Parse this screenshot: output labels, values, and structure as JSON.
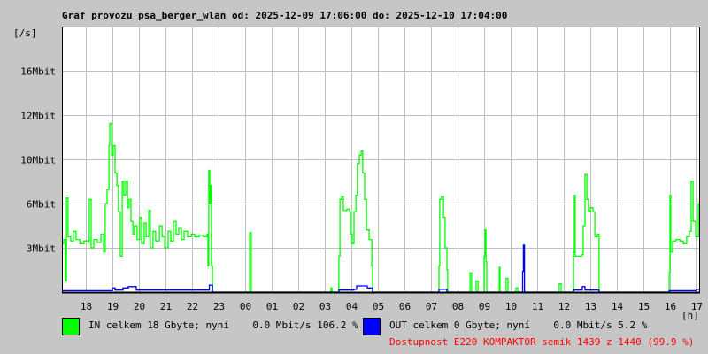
{
  "chart_data": {
    "type": "line",
    "title": "Graf provozu psa_berger_wlan od: 2025-12-09 17:06:00 do: 2025-12-10 17:04:00",
    "ylabel": "[/s]",
    "xlabel": "[h]",
    "x_unit": "hours since 2025-12-09 17:06",
    "xlim": [
      0,
      24
    ],
    "ylim": [
      0,
      19.2
    ],
    "y_unit": "Mbit/s",
    "grid": true,
    "y_ticks": [
      {
        "value": 3.2,
        "label": "3Mbit"
      },
      {
        "value": 6.4,
        "label": "6Mbit"
      },
      {
        "value": 9.6,
        "label": "10Mbit"
      },
      {
        "value": 12.8,
        "label": "12Mbit"
      },
      {
        "value": 16.0,
        "label": "16Mbit"
      }
    ],
    "x_ticks": [
      {
        "value": 0.9,
        "label": "18"
      },
      {
        "value": 1.9,
        "label": "19"
      },
      {
        "value": 2.9,
        "label": "20"
      },
      {
        "value": 3.9,
        "label": "21"
      },
      {
        "value": 4.9,
        "label": "22"
      },
      {
        "value": 5.9,
        "label": "23"
      },
      {
        "value": 6.9,
        "label": "00"
      },
      {
        "value": 7.9,
        "label": "01"
      },
      {
        "value": 8.9,
        "label": "02"
      },
      {
        "value": 9.9,
        "label": "03"
      },
      {
        "value": 10.9,
        "label": "04"
      },
      {
        "value": 11.9,
        "label": "05"
      },
      {
        "value": 12.9,
        "label": "06"
      },
      {
        "value": 13.9,
        "label": "07"
      },
      {
        "value": 14.9,
        "label": "08"
      },
      {
        "value": 15.9,
        "label": "09"
      },
      {
        "value": 16.9,
        "label": "10"
      },
      {
        "value": 17.9,
        "label": "11"
      },
      {
        "value": 18.9,
        "label": "12"
      },
      {
        "value": 19.9,
        "label": "13"
      },
      {
        "value": 20.9,
        "label": "14"
      },
      {
        "value": 21.9,
        "label": "15"
      },
      {
        "value": 22.9,
        "label": "16"
      },
      {
        "value": 23.9,
        "label": "17"
      }
    ],
    "series": [
      {
        "name": "IN",
        "color": "#00ff00",
        "points": [
          [
            0,
            3.5
          ],
          [
            0.07,
            3.8
          ],
          [
            0.13,
            0.8
          ],
          [
            0.17,
            6.8
          ],
          [
            0.23,
            4.0
          ],
          [
            0.33,
            3.7
          ],
          [
            0.43,
            4.4
          ],
          [
            0.53,
            3.8
          ],
          [
            0.67,
            3.5
          ],
          [
            0.83,
            3.7
          ],
          [
            1.0,
            3.6
          ],
          [
            1.03,
            6.7
          ],
          [
            1.1,
            3.2
          ],
          [
            1.2,
            3.8
          ],
          [
            1.33,
            3.6
          ],
          [
            1.47,
            4.2
          ],
          [
            1.57,
            2.9
          ],
          [
            1.63,
            6.4
          ],
          [
            1.7,
            7.4
          ],
          [
            1.77,
            10.6
          ],
          [
            1.8,
            12.2
          ],
          [
            1.87,
            9.9
          ],
          [
            1.93,
            10.6
          ],
          [
            2.0,
            8.6
          ],
          [
            2.07,
            7.7
          ],
          [
            2.13,
            5.8
          ],
          [
            2.2,
            2.6
          ],
          [
            2.27,
            8.0
          ],
          [
            2.33,
            7.0
          ],
          [
            2.4,
            8.0
          ],
          [
            2.47,
            6.1
          ],
          [
            2.53,
            6.7
          ],
          [
            2.6,
            5.1
          ],
          [
            2.67,
            4.2
          ],
          [
            2.73,
            4.8
          ],
          [
            2.83,
            3.8
          ],
          [
            2.93,
            5.4
          ],
          [
            3.0,
            3.5
          ],
          [
            3.1,
            5.0
          ],
          [
            3.17,
            4.0
          ],
          [
            3.27,
            5.9
          ],
          [
            3.33,
            3.2
          ],
          [
            3.43,
            4.4
          ],
          [
            3.53,
            3.7
          ],
          [
            3.67,
            4.8
          ],
          [
            3.77,
            4.0
          ],
          [
            3.87,
            3.2
          ],
          [
            4.0,
            4.4
          ],
          [
            4.1,
            3.7
          ],
          [
            4.2,
            5.1
          ],
          [
            4.3,
            4.2
          ],
          [
            4.4,
            4.6
          ],
          [
            4.5,
            3.8
          ],
          [
            4.6,
            4.4
          ],
          [
            4.73,
            4.0
          ],
          [
            4.87,
            4.2
          ],
          [
            5.0,
            4.0
          ],
          [
            5.17,
            4.1
          ],
          [
            5.33,
            4.0
          ],
          [
            5.47,
            4.2
          ],
          [
            5.5,
            1.9
          ],
          [
            5.53,
            8.8
          ],
          [
            5.57,
            6.4
          ],
          [
            5.6,
            7.7
          ],
          [
            5.63,
            1.9
          ],
          [
            5.67,
            0
          ],
          [
            7.03,
            0
          ],
          [
            7.07,
            4.3
          ],
          [
            7.13,
            0
          ],
          [
            10.13,
            0.3
          ],
          [
            10.17,
            0
          ],
          [
            10.43,
            2.6
          ],
          [
            10.47,
            6.7
          ],
          [
            10.53,
            6.9
          ],
          [
            10.6,
            5.9
          ],
          [
            10.73,
            6.0
          ],
          [
            10.83,
            5.8
          ],
          [
            10.87,
            4.2
          ],
          [
            10.93,
            3.5
          ],
          [
            11.0,
            5.8
          ],
          [
            11.07,
            7.0
          ],
          [
            11.13,
            9.3
          ],
          [
            11.2,
            9.9
          ],
          [
            11.27,
            10.2
          ],
          [
            11.33,
            8.6
          ],
          [
            11.4,
            6.7
          ],
          [
            11.47,
            4.5
          ],
          [
            11.57,
            3.8
          ],
          [
            11.67,
            1.9
          ],
          [
            11.7,
            0
          ],
          [
            14.2,
            1.9
          ],
          [
            14.23,
            6.7
          ],
          [
            14.3,
            6.9
          ],
          [
            14.37,
            5.4
          ],
          [
            14.43,
            3.2
          ],
          [
            14.5,
            1.6
          ],
          [
            14.53,
            0
          ],
          [
            15.37,
            1.4
          ],
          [
            15.43,
            0
          ],
          [
            15.6,
            0.8
          ],
          [
            15.67,
            0
          ],
          [
            15.9,
            2.6
          ],
          [
            15.93,
            4.5
          ],
          [
            15.97,
            2.2
          ],
          [
            16.0,
            0
          ],
          [
            16.47,
            1.8
          ],
          [
            16.5,
            0
          ],
          [
            16.73,
            1.0
          ],
          [
            16.8,
            0
          ],
          [
            17.1,
            0.3
          ],
          [
            17.17,
            0
          ],
          [
            18.73,
            0.6
          ],
          [
            18.8,
            0
          ],
          [
            19.27,
            2.9
          ],
          [
            19.3,
            7.0
          ],
          [
            19.33,
            2.6
          ],
          [
            19.47,
            2.6
          ],
          [
            19.57,
            2.7
          ],
          [
            19.63,
            4.8
          ],
          [
            19.7,
            8.5
          ],
          [
            19.77,
            6.7
          ],
          [
            19.83,
            5.8
          ],
          [
            19.9,
            6.1
          ],
          [
            20.0,
            5.8
          ],
          [
            20.07,
            4.0
          ],
          [
            20.17,
            4.2
          ],
          [
            20.23,
            0
          ],
          [
            22.87,
            1.4
          ],
          [
            22.9,
            7.0
          ],
          [
            22.93,
            2.9
          ],
          [
            23.0,
            3.7
          ],
          [
            23.13,
            3.8
          ],
          [
            23.27,
            3.7
          ],
          [
            23.4,
            3.5
          ],
          [
            23.53,
            4.0
          ],
          [
            23.63,
            4.4
          ],
          [
            23.7,
            8.0
          ],
          [
            23.77,
            5.1
          ],
          [
            23.87,
            4.0
          ],
          [
            23.97,
            6.4
          ],
          [
            24,
            6.4
          ]
        ]
      },
      {
        "name": "OUT",
        "color": "#0000ff",
        "points": [
          [
            0,
            0.1
          ],
          [
            1.9,
            0.3
          ],
          [
            2.0,
            0.15
          ],
          [
            2.3,
            0.3
          ],
          [
            2.5,
            0.4
          ],
          [
            2.8,
            0.15
          ],
          [
            5.5,
            0.15
          ],
          [
            5.55,
            0.5
          ],
          [
            5.67,
            0
          ],
          [
            10.43,
            0.15
          ],
          [
            11.0,
            0.2
          ],
          [
            11.1,
            0.45
          ],
          [
            11.5,
            0.3
          ],
          [
            11.7,
            0
          ],
          [
            14.2,
            0.2
          ],
          [
            14.5,
            0
          ],
          [
            17.35,
            1.5
          ],
          [
            17.38,
            3.4
          ],
          [
            17.42,
            0
          ],
          [
            19.27,
            0.15
          ],
          [
            19.6,
            0.4
          ],
          [
            19.7,
            0.15
          ],
          [
            20.23,
            0
          ],
          [
            22.87,
            0.1
          ],
          [
            23.9,
            0.2
          ],
          [
            24,
            0.2
          ]
        ]
      }
    ],
    "legend": [
      {
        "color": "#00ff00",
        "text": "IN celkem 18 Gbyte; nyní    0.0 Mbit/s 106.2 %"
      },
      {
        "color": "#0000ff",
        "text": "OUT celkem 0 Gbyte; nyní    0.0 Mbit/s 5.2 %"
      }
    ],
    "annotation": "Dostupnost E220 KOMPAKTOR semik 1439 z 1440 (99.9 %)",
    "annotation_color": "#ff0000"
  }
}
